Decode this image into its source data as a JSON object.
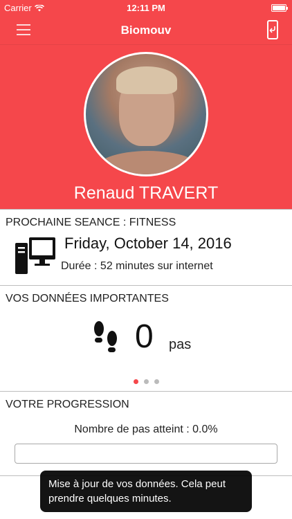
{
  "status_bar": {
    "carrier": "Carrier",
    "time": "12:11 PM"
  },
  "nav": {
    "title": "Biomouv",
    "menu_icon": "hamburger-menu-icon",
    "logout_icon": "phone-exit-icon"
  },
  "profile": {
    "name": "Renaud TRAVERT"
  },
  "session": {
    "title": "PROCHAINE SEANCE : FITNESS",
    "date": "Friday, October 14, 2016",
    "duration": "Durée : 52 minutes sur internet",
    "icon": "desktop-computer-icon"
  },
  "data": {
    "title": "VOS DONNÉES IMPORTANTES",
    "steps_value": "0",
    "steps_unit": "pas",
    "icon": "footprints-icon",
    "pages": 3,
    "active_page": 0
  },
  "progress": {
    "title": "VOTRE PROGRESSION",
    "label": "Nombre de pas atteint : 0.0%",
    "value": 0.0
  },
  "toast": {
    "message": "Mise à jour de vos données. Cela peut prendre quelques minutes."
  },
  "colors": {
    "accent": "#f5474b"
  }
}
